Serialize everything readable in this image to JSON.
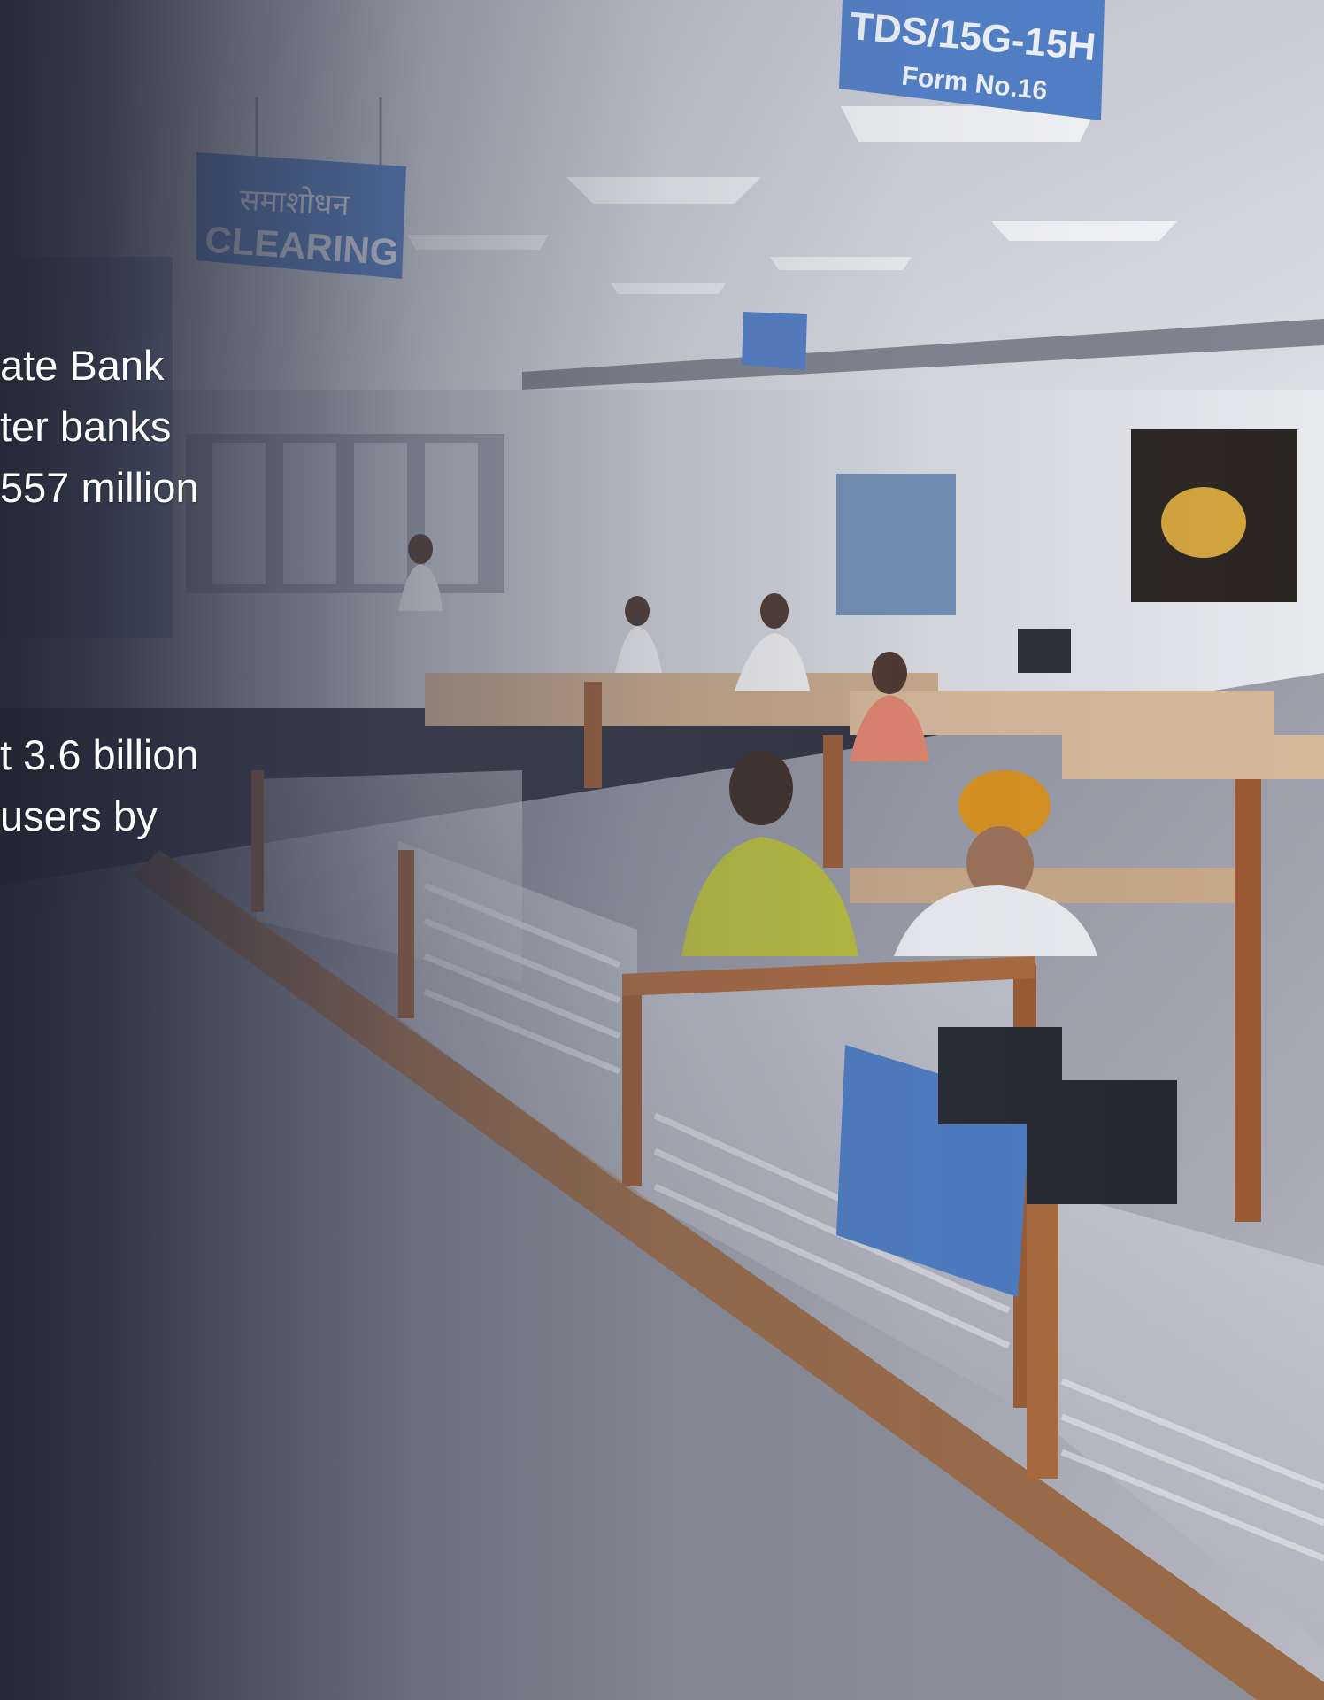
{
  "photo": {
    "signs": {
      "clearing_hindi": "समाशोधन",
      "clearing": "CLEARING",
      "tds_line1": "TDS/15G-15H",
      "tds_line2": "Form No.16"
    }
  },
  "overlay_text": {
    "block1": [
      "ate Bank",
      "ter banks",
      "557 million"
    ],
    "block2": [
      "t 3.6 billion",
      "users by"
    ]
  }
}
